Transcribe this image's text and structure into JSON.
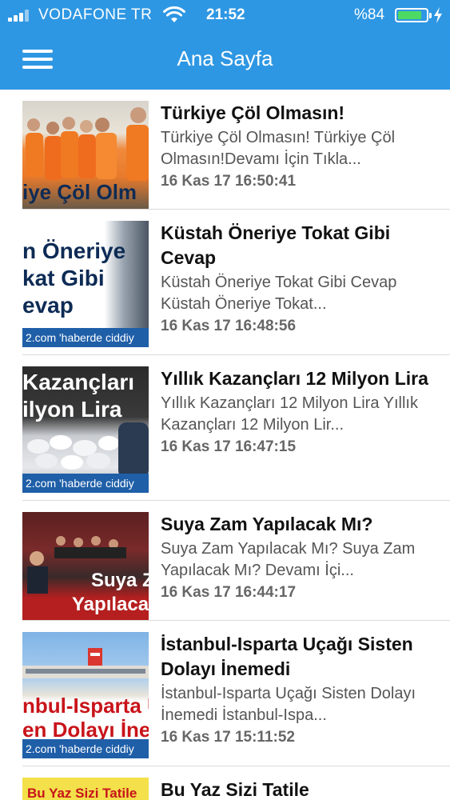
{
  "status_bar": {
    "carrier": "VODAFONE TR",
    "time": "21:52",
    "battery_percent": "%84",
    "battery_level": 0.84
  },
  "nav": {
    "title": "Ana Sayfa"
  },
  "articles": [
    {
      "title": "Türkiye Çöl Olmasın!",
      "summary": "Türkiye Çöl Olmasın!   Türkiye Çöl Olmasın!Devamı İçin Tıkla...",
      "date": "16 Kas 17 16:50:41",
      "thumb_text": "iye Çöl Olm"
    },
    {
      "title": "Küstah Öneriye Tokat Gibi Cevap",
      "summary": "Küstah Öneriye Tokat Gibi Cevap   Küstah Öneriye Tokat...",
      "date": "16 Kas 17 16:48:56",
      "thumb_text_lines": [
        "n Öneriye",
        "kat Gibi",
        "evap"
      ],
      "thumb_url": "2.com   'haberde ciddiy"
    },
    {
      "title": "Yıllık Kazançları 12 Milyon Lira",
      "summary": "Yıllık Kazançları 12 Milyon Lira Yıllık Kazançları 12 Milyon Lir...",
      "date": "16 Kas 17 16:47:15",
      "thumb_text_lines": [
        "Kazançları",
        "ilyon Lira"
      ],
      "thumb_url": "2.com   'haberde ciddiy"
    },
    {
      "title": "Suya Zam Yapılacak Mı?",
      "summary": "Suya Zam Yapılacak Mı?   Suya Zam Yapılacak Mı? Devamı İçi...",
      "date": "16 Kas 17 16:44:17",
      "thumb_text_lines": [
        "Suya Z",
        "Yapılacak"
      ]
    },
    {
      "title": "İstanbul-Isparta Uçağı Sisten Dolayı İnemedi",
      "summary": "İstanbul-Isparta Uçağı Sisten Dolayı İnemedi   İstanbul-Ispa...",
      "date": "16 Kas 17 15:11:52",
      "thumb_text_lines": [
        "nbul-Isparta U",
        "en Dolayı İner"
      ],
      "thumb_url": "2.com   'haberde ciddiy"
    },
    {
      "title": "Bu Yaz Sizi Tatile",
      "thumb_text": "Bu Yaz Sizi Tatile"
    }
  ]
}
